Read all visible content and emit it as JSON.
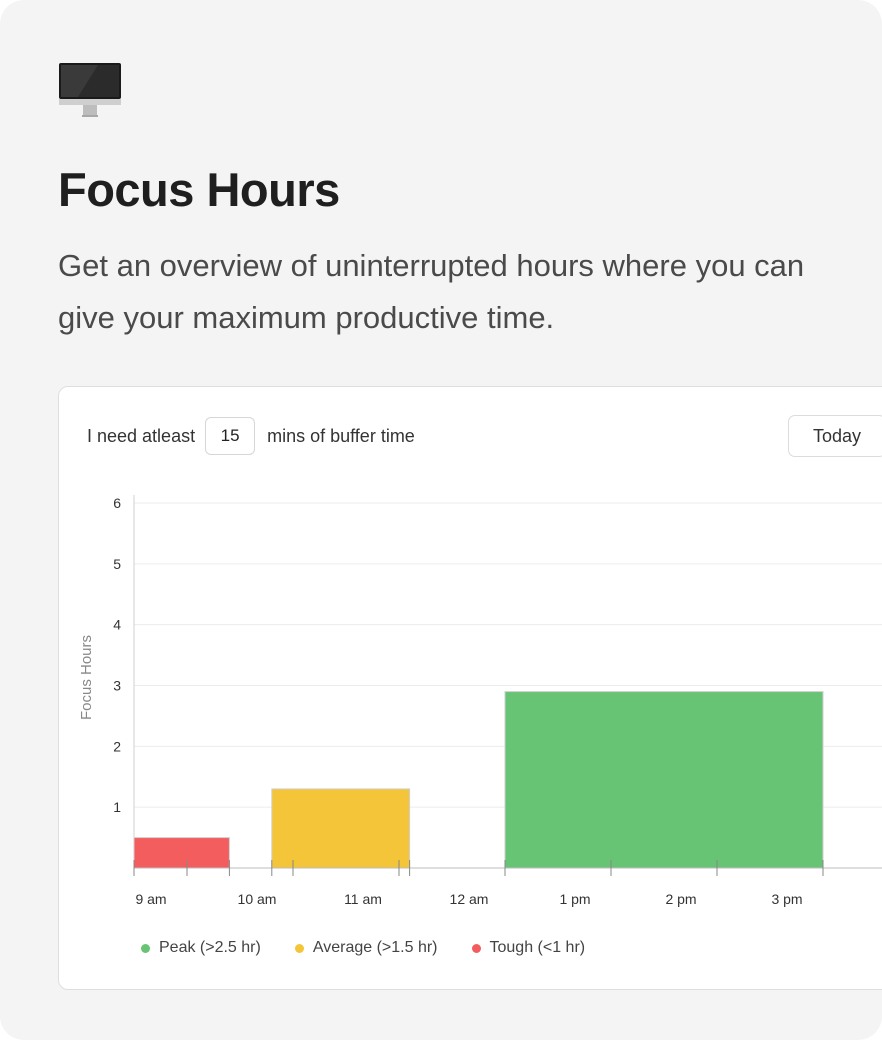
{
  "header": {
    "icon": "monitor-icon",
    "title": "Focus Hours",
    "subtitle": "Get an overview of uninterrupted hours where you can give your maximum productive time."
  },
  "controls": {
    "buffer_prefix": "I need atleast",
    "buffer_value": "15",
    "buffer_suffix": "mins of buffer time",
    "range_button": "Today"
  },
  "chart_data": {
    "type": "bar",
    "ylabel": "Focus Hours",
    "ylim": [
      0,
      6
    ],
    "yticks": [
      1,
      2,
      3,
      4,
      5,
      6
    ],
    "grid": true,
    "x_start_hour": 9,
    "x_end_hour": 16,
    "xticks": [
      {
        "hour": 9,
        "label": "9 am"
      },
      {
        "hour": 10,
        "label": "10 am"
      },
      {
        "hour": 11,
        "label": "11 am"
      },
      {
        "hour": 12,
        "label": "12 am"
      },
      {
        "hour": 13,
        "label": "1 pm"
      },
      {
        "hour": 14,
        "label": "2 pm"
      },
      {
        "hour": 15,
        "label": "3 pm"
      }
    ],
    "bars": [
      {
        "start": 9.0,
        "end": 9.9,
        "value": 0.5,
        "category": "Tough (<1 hr)"
      },
      {
        "start": 10.3,
        "end": 11.6,
        "value": 1.3,
        "category": "Average (>1.5 hr)"
      },
      {
        "start": 12.5,
        "end": 15.5,
        "value": 2.9,
        "category": "Peak (>2.5 hr)"
      }
    ],
    "legend_position": "bottom",
    "legend": [
      {
        "label": "Peak (>2.5 hr)",
        "color": "#66c474"
      },
      {
        "label": "Average (>1.5 hr)",
        "color": "#f4c538"
      },
      {
        "label": "Tough (<1 hr)",
        "color": "#f45d5d"
      }
    ]
  },
  "colors": {
    "background": "#f4f4f4",
    "card": "#ffffff",
    "peak": "#66c474",
    "average": "#f4c538",
    "tough": "#f45d5d"
  }
}
